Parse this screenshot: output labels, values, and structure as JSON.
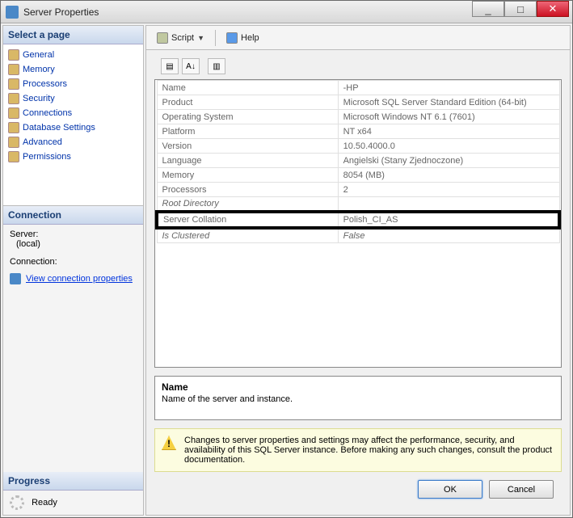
{
  "window": {
    "title": "Server Properties"
  },
  "sidebar": {
    "select_page_header": "Select a page",
    "pages": [
      {
        "label": "General"
      },
      {
        "label": "Memory"
      },
      {
        "label": "Processors"
      },
      {
        "label": "Security"
      },
      {
        "label": "Connections"
      },
      {
        "label": "Database Settings"
      },
      {
        "label": "Advanced"
      },
      {
        "label": "Permissions"
      }
    ],
    "connection_header": "Connection",
    "server_label": "Server:",
    "server_value": "(local)",
    "connection_label": "Connection:",
    "connection_value": "",
    "view_connection_link": "View connection properties",
    "progress_header": "Progress",
    "progress_status": "Ready"
  },
  "toolbar": {
    "script": "Script",
    "help": "Help"
  },
  "grid": {
    "rows": [
      {
        "key": "Name",
        "value": "-HP"
      },
      {
        "key": "Product",
        "value": "Microsoft SQL Server Standard Edition (64-bit)"
      },
      {
        "key": "Operating System",
        "value": "Microsoft Windows NT 6.1 (7601)"
      },
      {
        "key": "Platform",
        "value": "NT x64"
      },
      {
        "key": "Version",
        "value": "10.50.4000.0"
      },
      {
        "key": "Language",
        "value": "Angielski (Stany Zjednoczone)"
      },
      {
        "key": "Memory",
        "value": "8054 (MB)"
      },
      {
        "key": "Processors",
        "value": "2"
      },
      {
        "key": "Root Directory",
        "value": "",
        "obscured": true
      },
      {
        "key": "Server Collation",
        "value": "Polish_CI_AS",
        "highlight": true
      },
      {
        "key": "Is Clustered",
        "value": "False",
        "obscured": true
      }
    ]
  },
  "description": {
    "title": "Name",
    "text": "Name of the server and instance."
  },
  "warning": {
    "text": "Changes to server properties and settings may affect the performance, security, and availability of this SQL Server instance. Before making any such changes, consult the product documentation."
  },
  "buttons": {
    "ok": "OK",
    "cancel": "Cancel"
  }
}
